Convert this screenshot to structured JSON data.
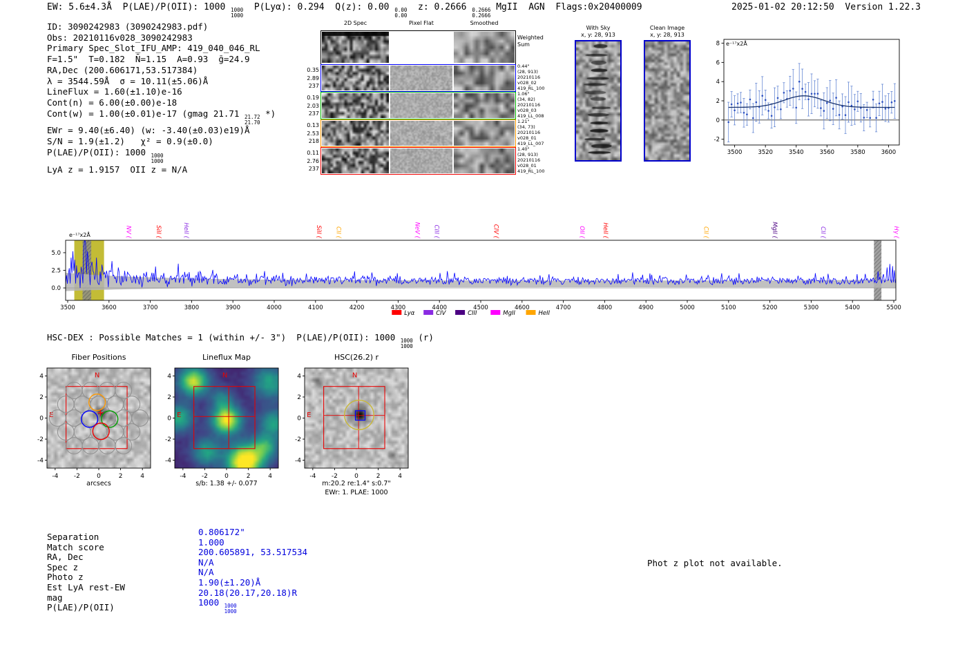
{
  "header": {
    "left_segments": [
      {
        "t": "EW: 5.6±4.3Å  P(LAE)/P(OII): 1000 "
      },
      {
        "frac": [
          "1000",
          "1000"
        ]
      },
      {
        "t": "  P(Lyα): 0.294  Q(z): 0.00 "
      },
      {
        "frac": [
          "0.00",
          "0.00"
        ]
      },
      {
        "t": "  z: 0.2666 "
      },
      {
        "frac": [
          "0.2666",
          "0.2666"
        ]
      },
      {
        "t": " MgII  AGN  Flags:0x20400009"
      }
    ],
    "datetime": "2025-01-02 20:12:50",
    "version": "Version 1.22.3"
  },
  "info": {
    "lines": [
      [
        {
          "t": "ID: 3090242983 (3090242983.pdf)"
        }
      ],
      [
        {
          "t": "Obs: 20210116v028_3090242983"
        }
      ],
      [
        {
          "t": "Primary Spec_Slot_IFU_AMP: 419_040_046_RL"
        }
      ],
      [
        {
          "t": "F=1.5\"  T=0.182  N̄=1.15  A=0.93  ḡ=24.9"
        }
      ],
      [
        {
          "t": "RA,Dec (200.606171,53.517384)"
        }
      ],
      [
        {
          "t": "λ = 3544.59Å  σ = 10.11(±5.06)Å"
        }
      ],
      [
        {
          "t": "LineFlux = 1.60(±1.10)e-16"
        }
      ],
      [
        {
          "t": "Cont(n) = 6.00(±0.00)e-18"
        }
      ],
      [
        {
          "t": "Cont(w) = 1.00(±0.01)e-17 (gmag 21.71 "
        },
        {
          "frac": [
            "21.72",
            "21.70"
          ]
        },
        {
          "t": " *)"
        }
      ],
      [
        {
          "t": "EWr = 9.40(±6.40) (w: -3.40(±0.03)e19)Å"
        }
      ],
      [
        {
          "t": "S/N = 1.9(±1.2)   χ² = 0.9(±0.0)"
        }
      ],
      [
        {
          "t": "P(LAE)/P(OII): 1000 "
        },
        {
          "frac": [
            "1000",
            "1000"
          ]
        }
      ],
      [
        {
          "t": "LyA z = 1.9157  OII z = N/A"
        }
      ]
    ]
  },
  "spec2d": {
    "col_titles": [
      "2D Spec",
      "Pixel Flat",
      "Smoothed"
    ],
    "weighted_label": [
      "Weighted",
      "Sum"
    ],
    "rows": [
      {
        "left": [
          "0.35",
          "2.89",
          "237"
        ],
        "right": [
          "0.44\"",
          "(28, 913)",
          "20210116",
          "v028_02",
          "419_RL_100"
        ],
        "color": "#0000ff"
      },
      {
        "left": [
          "0.19",
          "2.03",
          "237"
        ],
        "right": [
          "1.06\"",
          "(34, 82)",
          "20210116",
          "v028_03",
          "419_LL_008"
        ],
        "color": "#00b400"
      },
      {
        "left": [
          "0.13",
          "2.53",
          "218"
        ],
        "right": [
          "1.21\"",
          "(34, 73)",
          "20210116",
          "v028_01",
          "419_LL_007"
        ],
        "color": "#ff9900"
      },
      {
        "left": [
          "0.11",
          "2.76",
          "237"
        ],
        "right": [
          "1.40\"",
          "(28, 913)",
          "20210116",
          "v028_01",
          "419_RL_100"
        ],
        "color": "#ee0000"
      }
    ]
  },
  "sky_panels": [
    {
      "title": "With Sky",
      "subtitle": "x, y: 28, 913"
    },
    {
      "title": "Clean Image",
      "subtitle": "x, y: 28, 913"
    }
  ],
  "chart_data": [
    {
      "type": "line",
      "name": "full-spectrum",
      "title": "",
      "units_label": "e⁻¹⁷x2Å",
      "xlim": [
        3495,
        5505
      ],
      "ylim": [
        -1.76,
        6.76
      ],
      "xticks": [
        3500,
        3600,
        3700,
        3800,
        3900,
        4000,
        4100,
        4200,
        4300,
        4400,
        4500,
        4600,
        4700,
        4800,
        4900,
        5000,
        5100,
        5200,
        5300,
        5400,
        5500
      ],
      "yticks": [
        0.0,
        2.5,
        5.0
      ],
      "line_color": "#0000ff",
      "error_band_color": "#b5b5b5",
      "highlight_band": {
        "x0": 3516,
        "x1": 3588,
        "color": "#bdb520"
      },
      "hatch_bands": [
        {
          "x0": 3536,
          "x1": 3557
        },
        {
          "x0": 5452,
          "x1": 5470
        }
      ],
      "main_line": {
        "wavelength": 3544.59,
        "peak_value": 6.9
      },
      "emission_lines": [
        {
          "name": "NV",
          "wavelength": 3638,
          "color": "#ff00ff"
        },
        {
          "name": "SiII",
          "wavelength": 3711,
          "color": "#ff0000"
        },
        {
          "name": "HeII",
          "wavelength": 3778,
          "color": "#8a2be2"
        },
        {
          "name": "SiII",
          "wavelength": 4099,
          "color": "#ff0000"
        },
        {
          "name": "CII",
          "wavelength": 4146,
          "color": "#ffa500"
        },
        {
          "name": "NeV",
          "wavelength": 4337,
          "color": "#ff00ff"
        },
        {
          "name": "CIII",
          "wavelength": 4384,
          "color": "#8a2be2"
        },
        {
          "name": "CIV",
          "wavelength": 4528,
          "color": "#ff0000"
        },
        {
          "name": "OII",
          "wavelength": 4736,
          "color": "#ff00ff"
        },
        {
          "name": "HeII",
          "wavelength": 4793,
          "color": "#ff0000"
        },
        {
          "name": "CII",
          "wavelength": 5036,
          "color": "#ffa500"
        },
        {
          "name": "MgII",
          "wavelength": 5202,
          "color": "#4b0082"
        },
        {
          "name": "CII",
          "wavelength": 5319,
          "color": "#8a2be2"
        },
        {
          "name": "Hγ",
          "wavelength": 5497,
          "color": "#ff00ff"
        }
      ],
      "legend": [
        {
          "label": "Lyα",
          "color": "#ff0000"
        },
        {
          "label": "CIV",
          "color": "#8a2be2"
        },
        {
          "label": "CIII",
          "color": "#4b0082"
        },
        {
          "label": "MgII",
          "color": "#ff00ff"
        },
        {
          "label": "HeII",
          "color": "#ffa500"
        }
      ]
    },
    {
      "type": "scatter",
      "name": "line-fit-inset",
      "units_label": "e⁻¹⁷x2Å",
      "xlim": [
        3493,
        3607
      ],
      "ylim": [
        -2.6,
        8.4
      ],
      "xticks": [
        3500,
        3520,
        3540,
        3560,
        3580,
        3600
      ],
      "yticks": [
        -2,
        0,
        2,
        4,
        6,
        8
      ],
      "point_color": "#2a4fc0",
      "errorbar_color": "#6688d4",
      "fit_color": "#15306e",
      "fit": {
        "center": 3545,
        "sigma": 13,
        "amplitude": 1.2,
        "baseline": 1.32
      }
    }
  ],
  "hscdex": {
    "segments": [
      {
        "t": "HSC-DEX : Possible Matches = 1 (within +/- 3\")  P(LAE)/P(OII): 1000 "
      },
      {
        "frac": [
          "1000",
          "1000"
        ]
      },
      {
        "t": " (r)"
      }
    ]
  },
  "cutouts": {
    "panels": [
      {
        "title": "Fiber Positions",
        "xlabel": "arcsecs",
        "ticks": [
          -4,
          -2,
          0,
          2,
          4
        ],
        "north": "N",
        "east": "E",
        "caption": "",
        "caption2": ""
      },
      {
        "title": "Lineflux Map",
        "ticks": [
          -4,
          -2,
          0,
          2,
          4
        ],
        "north": "N",
        "east": "E",
        "caption": "s/b: 1.38 +/- 0.077",
        "caption2": ""
      },
      {
        "title": "HSC(26.2) r",
        "ticks": [
          -4,
          -2,
          0,
          2,
          4
        ],
        "north": "N",
        "east": "E",
        "caption": "m:20.2 re:1.4\" s:0.7\"",
        "caption2": "EWr: 1. PLAE: 1000"
      }
    ]
  },
  "match_table": {
    "rows": [
      {
        "label": "Separation",
        "value": [
          {
            "t": "0.806172\""
          }
        ]
      },
      {
        "label": "Match score",
        "value": [
          {
            "t": "1.000"
          }
        ]
      },
      {
        "label": "RA, Dec",
        "value": [
          {
            "t": "200.605891, 53.517534"
          }
        ]
      },
      {
        "label": "Spec z",
        "value": [
          {
            "t": "N/A"
          }
        ]
      },
      {
        "label": "Photo z",
        "value": [
          {
            "t": "N/A"
          }
        ]
      },
      {
        "label": "Est LyA rest-EW",
        "value": [
          {
            "t": "1.90(±1.20)Å"
          }
        ]
      },
      {
        "label": "mag",
        "value": [
          {
            "t": "20.18(20.17,20.18)R"
          }
        ]
      },
      {
        "label": "P(LAE)/P(OII)",
        "value": [
          {
            "t": "1000 "
          },
          {
            "frac": [
              "1000",
              "1000"
            ]
          }
        ]
      }
    ]
  },
  "photz_note": "Phot z plot not available."
}
